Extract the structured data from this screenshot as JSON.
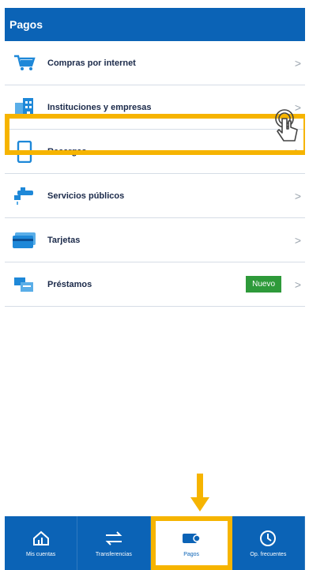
{
  "header": {
    "title": "Pagos"
  },
  "menu": [
    {
      "label": "Compras por internet",
      "icon": "shopping-cart-icon"
    },
    {
      "label": "Instituciones y empresas",
      "icon": "building-icon"
    },
    {
      "label": "Recargas",
      "icon": "phone-icon"
    },
    {
      "label": "Servicios públicos",
      "icon": "faucet-icon"
    },
    {
      "label": "Tarjetas",
      "icon": "card-icon"
    },
    {
      "label": "Préstamos",
      "icon": "loan-icon",
      "badge": "Nuevo"
    }
  ],
  "chevron": ">",
  "tabs": [
    {
      "label": "Mis cuentas",
      "icon": "house-chart-icon"
    },
    {
      "label": "Transferencias",
      "icon": "arrows-icon"
    },
    {
      "label": "Pagos",
      "icon": "card-pay-icon",
      "active": true
    },
    {
      "label": "Op. frecuentes",
      "icon": "clock-icon"
    }
  ],
  "colors": {
    "brand": "#0b63b6",
    "highlight": "#f6b400",
    "badge": "#2e9a3a"
  }
}
